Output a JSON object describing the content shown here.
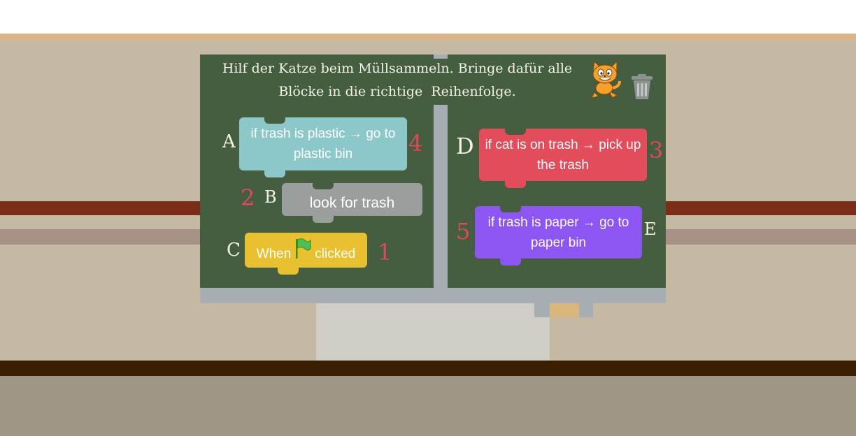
{
  "instructions": {
    "line1": "Hilf der Katze beim Müllsammeln. Bringe dafür alle",
    "line2": "Blöcke in die richtige  Reihenfolge."
  },
  "blocks": [
    {
      "letter": "A",
      "text": "if trash is plastic → go to plastic bin",
      "order": "4",
      "color": "#8cc7c9"
    },
    {
      "letter": "B",
      "text": "look for trash",
      "order": "2",
      "color": "#9a9e9c"
    },
    {
      "letter": "C",
      "text_before": "When",
      "text_after": "clicked",
      "order": "1",
      "color": "#e9c02f",
      "icon": "green-flag-icon"
    },
    {
      "letter": "D",
      "text": "if cat is on trash → pick up the trash",
      "order": "3",
      "color": "#e34c5b"
    },
    {
      "letter": "E",
      "text": "if trash is paper → go to paper bin",
      "order": "5",
      "color": "#8d55f2"
    }
  ],
  "icons": {
    "cat": "scratch-cat-icon",
    "trash": "trash-can-icon",
    "flag": "green-flag-icon"
  },
  "colors": {
    "chalkboard": "#455e3f",
    "frame": "#a6adb3",
    "number_red": "#e0475a"
  }
}
